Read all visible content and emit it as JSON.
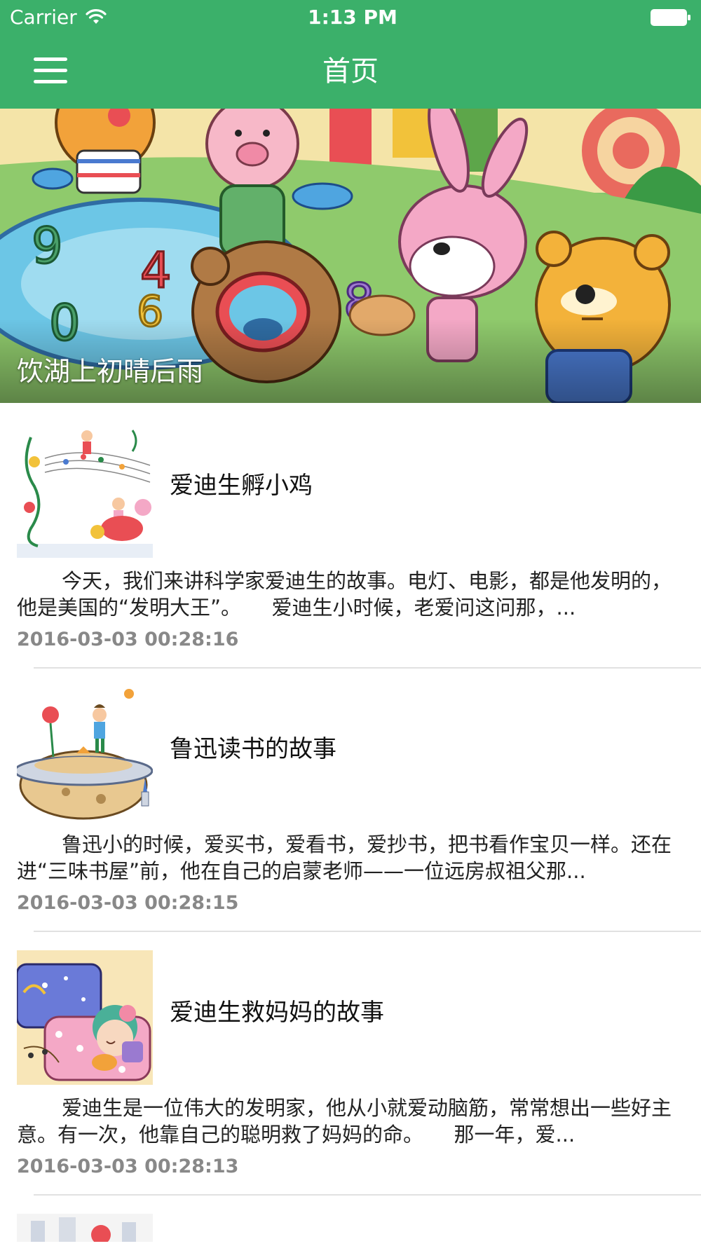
{
  "status_bar": {
    "carrier": "Carrier",
    "time": "1:13 PM"
  },
  "nav": {
    "title": "首页"
  },
  "banner": {
    "caption": "饮湖上初晴后雨"
  },
  "articles": [
    {
      "title": "爱迪生孵小鸡",
      "description": "今天，我们来讲科学家爱迪生的故事。电灯、电影，都是他发明的，他是美国的“发明大王”。　　爱迪生小时候，老爱问这问那，...",
      "date": "2016-03-03 00:28:16"
    },
    {
      "title": "鲁迅读书的故事",
      "description": "鲁迅小的时候，爱买书，爱看书，爱抄书，把书看作宝贝一样。还在进“三味书屋”前，他在自己的启蒙老师——一位远房叔祖父那...",
      "date": "2016-03-03 00:28:15"
    },
    {
      "title": "爱迪生救妈妈的故事",
      "description": "爱迪生是一位伟大的发明家，他从小就爱动脑筋，常常想出一些好主意。有一次，他靠自己的聪明救了妈妈的命。　　那一年，爱...",
      "date": "2016-03-03 00:28:13"
    }
  ],
  "colors": {
    "nav_background": "#3BB06A",
    "date_text": "#888888",
    "divider": "#E1E1E1"
  },
  "icons": {
    "menu": "hamburger-menu-icon",
    "wifi": "wifi-icon",
    "battery": "battery-icon"
  }
}
